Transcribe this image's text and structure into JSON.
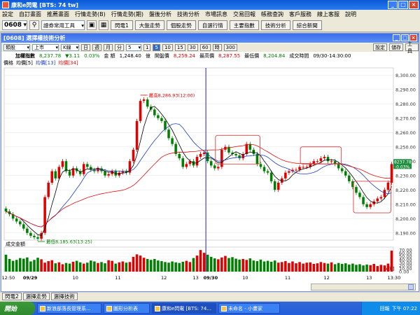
{
  "window": {
    "title": "康和e閃電 [BTS: 74 tw]",
    "min": "_",
    "max": "□",
    "close": "×"
  },
  "menu": [
    "設定",
    "自訂畫面",
    "推薦畫面",
    "行情走勢(B)",
    "行情走勢(期)",
    "盤後分析",
    "技術分析",
    "市場訊息",
    "交易回報",
    "帳務查詢",
    "客戶服務",
    "線上客服",
    "說明"
  ],
  "toolbar": {
    "stock_code": "0608",
    "search_icon": "search-icon",
    "tool_select": "證券常用工具",
    "buttons": [
      "閃電1",
      "大盤走勢",
      "個股走勢",
      "自選行情",
      "主要指數",
      "技術分析",
      "綜合新聞"
    ]
  },
  "inner": {
    "title": "[0608] 選擇權技術分析",
    "controls": {
      "type_select": "類股",
      "market_select": "上市",
      "chart_select": "K線",
      "periods": [
        "日",
        "週",
        "月",
        "分",
        "5",
        "1",
        "5",
        "10",
        "15",
        "30",
        "60",
        "時",
        "300"
      ],
      "period_select": "5",
      "right_buttons": [
        "設定",
        "儲存",
        "工具"
      ]
    },
    "info": {
      "name": "加權指數",
      "price": "8,237.78",
      "change": "▼3.11",
      "pct": "0.03%",
      "label_amount": "金",
      "label_qty": "額",
      "amount": "1,248.40",
      "unit": "億",
      "label_open": "開盤價",
      "open": "8,259.24",
      "label_high": "最高價",
      "high": "8,287.55",
      "label_low": "最低價",
      "low": "8,204.84",
      "label_time": "成交時間",
      "time": "09/30-14:30:00"
    },
    "legend": [
      "價格",
      "均價[5]",
      "均價[13]",
      "均價[34]"
    ],
    "annotations": {
      "high": "最高8,286.93(12:00)",
      "low": "最低8,185.63(13:25)"
    },
    "current_price_tag": "8237.78",
    "current_change_tag": "-0.03%",
    "volume_title": "成交金額",
    "volume_unit": "[x億]"
  },
  "chart_data": {
    "type": "candlestick",
    "price_axis": {
      "ylim": [
        8185,
        8305
      ],
      "ticks": [
        "8,300.00",
        "8,290.00",
        "8,280.00",
        "8,270.00",
        "8,260.00",
        "8,250.00",
        "8,240.00",
        "8,230.00",
        "8,220.00",
        "8,210.00",
        "8,200.00",
        "8,190.00"
      ]
    },
    "volume_axis": {
      "ylim": [
        0,
        75
      ],
      "ticks": [
        "70.00",
        "60.00",
        "50.00",
        "40.00",
        "30.00",
        "20.00",
        "10.00",
        "0.00"
      ]
    },
    "x_ticks": [
      "12:50",
      "09/29",
      "10",
      "11",
      "12",
      "13",
      "09/30",
      "10",
      "11",
      "12",
      "13",
      "13:30"
    ],
    "close": [
      8205,
      8203,
      8200,
      8198,
      8196,
      8193,
      8190,
      8188,
      8187,
      8186,
      8190,
      8215,
      8225,
      8233,
      8228,
      8236,
      8240,
      8233,
      8230,
      8235,
      8233,
      8231,
      8238,
      8236,
      8234,
      8233,
      8235,
      8233,
      8230,
      8231,
      8233,
      8230,
      8232,
      8233,
      8232,
      8240,
      8248,
      8268,
      8282,
      8283,
      8278,
      8276,
      8272,
      8270,
      8268,
      8262,
      8256,
      8252,
      8245,
      8242,
      8236,
      8238,
      8240,
      8237,
      8243,
      8245,
      8246,
      8240,
      8237,
      8235,
      8236,
      8248,
      8250,
      8246,
      8245,
      8244,
      8242,
      8245,
      8252,
      8248,
      8245,
      8238,
      8236,
      8233,
      8232,
      8226,
      8220,
      8225,
      8228,
      8232,
      8233,
      8234,
      8234,
      8236,
      8236,
      8236,
      8238,
      8240,
      8240,
      8242,
      8243,
      8240,
      8240,
      8238,
      8235,
      8233,
      8230,
      8226,
      8222,
      8218,
      8215,
      8210,
      8208,
      8210,
      8212,
      8214,
      8215,
      8220,
      8225,
      8238
    ],
    "volume": [
      55,
      41,
      35,
      38,
      44,
      42,
      46,
      33,
      38,
      45,
      40,
      29,
      34,
      37,
      27,
      30,
      24,
      28,
      26,
      32,
      35,
      30,
      26,
      29,
      36,
      33,
      28,
      31,
      27,
      37,
      35,
      26,
      30,
      33,
      29,
      31,
      48,
      56,
      52,
      45,
      41,
      38,
      41,
      36,
      34,
      31,
      29,
      33,
      30,
      28,
      32,
      35,
      31,
      44,
      52,
      70,
      61,
      55,
      48,
      43,
      40,
      46,
      51,
      44,
      47,
      42,
      39,
      41,
      38,
      43,
      36,
      34,
      39,
      33,
      35,
      32,
      36,
      29,
      31,
      34,
      28,
      33,
      27,
      31,
      26,
      29,
      30,
      25,
      27,
      31,
      28,
      26,
      30,
      24,
      28,
      25,
      27,
      23,
      26,
      22,
      24,
      20,
      23,
      21,
      25,
      18,
      22,
      20,
      26,
      68
    ],
    "ma5_label": "均價[5]",
    "ma13_label": "均價[13]",
    "ma34_label": "均價[34]"
  },
  "tabs": [
    "閃電2",
    "選擇走勢",
    "選擇技術"
  ],
  "taskbar": {
    "start": "開始",
    "tasks": [
      "新浪部落長管理系...",
      "圖形分析表",
      "康和e閃電 [BTS: 74...",
      "未命名 - 小畫家"
    ],
    "tray_text": "回報",
    "clock": "下午 07:22"
  },
  "colors": {
    "up": "#e00000",
    "down": "#008000",
    "ma5": "#000000",
    "ma13": "#1f3fbf",
    "ma34": "#e01010",
    "highlight": "#e04040",
    "crosshair": "#2020c0"
  }
}
